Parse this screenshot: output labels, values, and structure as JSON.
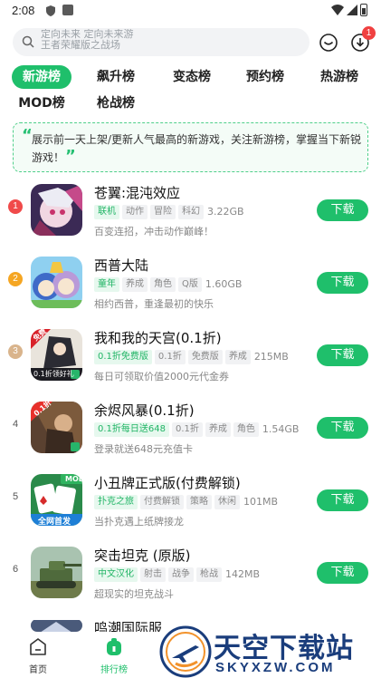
{
  "status_bar": {
    "time": "2:08"
  },
  "search": {
    "placeholder_lines": [
      "定向未来 定向未来游",
      "王者荣耀版之战场"
    ],
    "notification_count": "1"
  },
  "tabs": [
    {
      "label": "新游榜",
      "active": true
    },
    {
      "label": "飙升榜",
      "active": false
    },
    {
      "label": "变态榜",
      "active": false
    },
    {
      "label": "预约榜",
      "active": false
    },
    {
      "label": "热游榜",
      "active": false
    },
    {
      "label": "MOD榜",
      "active": false
    },
    {
      "label": "枪战榜",
      "active": false
    }
  ],
  "notice": {
    "open_quote": "“",
    "text": "展示前一天上架/更新人气最高的新游戏，关注新游榜，掌握当下新锐游戏！",
    "close_quote": "”"
  },
  "games": [
    {
      "rank": "1",
      "title": "苍翼:混沌效应",
      "tags": [
        {
          "t": "联机",
          "hl": true
        },
        {
          "t": "动作",
          "hl": false
        },
        {
          "t": "冒险",
          "hl": false
        },
        {
          "t": "科幻",
          "hl": false
        }
      ],
      "size": "3.22GB",
      "desc": "百变连招，冲击动作巅峰！",
      "button": "下载"
    },
    {
      "rank": "2",
      "title": "西普大陆",
      "tags": [
        {
          "t": "童年",
          "hl": true
        },
        {
          "t": "养成",
          "hl": false
        },
        {
          "t": "角色",
          "hl": false
        },
        {
          "t": "Q版",
          "hl": false
        }
      ],
      "size": "1.60GB",
      "desc": "相约西普，重逢最初的快乐",
      "button": "下载"
    },
    {
      "rank": "3",
      "title": "我和我的天宫(0.1折)",
      "tags": [
        {
          "t": "0.1折免费版",
          "hl": true
        },
        {
          "t": "0.1折",
          "hl": false
        },
        {
          "t": "免费版",
          "hl": false
        },
        {
          "t": "养成",
          "hl": false
        }
      ],
      "size": "215MB",
      "desc": "每日可领取价值2000元代金券",
      "button": "下载"
    },
    {
      "rank": "4",
      "title": "余烬风暴(0.1折)",
      "tags": [
        {
          "t": "0.1折每日送648",
          "hl": true
        },
        {
          "t": "0.1折",
          "hl": false
        },
        {
          "t": "养成",
          "hl": false
        },
        {
          "t": "角色",
          "hl": false
        }
      ],
      "size": "1.54GB",
      "desc": "登录就送648元充值卡",
      "button": "下载"
    },
    {
      "rank": "5",
      "title": "小丑牌正式版(付费解锁)",
      "tags": [
        {
          "t": "扑克之旅",
          "hl": true
        },
        {
          "t": "付费解锁",
          "hl": false
        },
        {
          "t": "策略",
          "hl": false
        },
        {
          "t": "休闲",
          "hl": false
        }
      ],
      "size": "101MB",
      "desc": "当扑克遇上纸牌接龙",
      "button": "下载"
    },
    {
      "rank": "6",
      "title": "突击坦克 (原版)",
      "tags": [
        {
          "t": "中文汉化",
          "hl": true
        },
        {
          "t": "射击",
          "hl": false
        },
        {
          "t": "战争",
          "hl": false
        },
        {
          "t": "枪战",
          "hl": false
        }
      ],
      "size": "142MB",
      "desc": "超现实的坦克战斗",
      "button": "下载"
    },
    {
      "rank": "",
      "title": "鸣潮国际服",
      "tags": [],
      "size": "",
      "desc": "",
      "button": ""
    }
  ],
  "colors": {
    "accent": "#1fbf6b",
    "rank1": "#f04a4a",
    "rank2": "#f5a623",
    "rank3": "#d9b48c"
  },
  "bottom_nav": [
    {
      "label": "首页",
      "icon": "home-icon"
    },
    {
      "label": "排行榜",
      "icon": "ranking-icon"
    }
  ],
  "watermark": {
    "cn": "天空下载站",
    "en": "SKYXZW.COM"
  },
  "thumb_badges": {
    "g3_corner": "免费",
    "g3_label": "0.1折领好礼",
    "g4_corner": "0.1折",
    "g5_label": "MOD",
    "g5_banner": "全网首发"
  }
}
